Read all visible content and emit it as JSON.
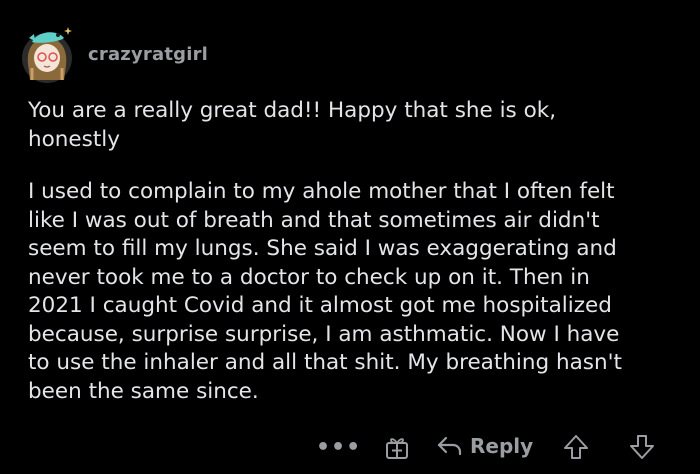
{
  "comment": {
    "username": "crazyratgirl",
    "paragraphs": [
      "You are a really great dad!! Happy that she is ok,\nhonestly",
      "I used to complain to my ahole mother that I often felt\nlike I was out of breath and that sometimes air didn't\nseem to fill my lungs. She said I was exaggerating and\nnever took me to a doctor to check up on it. Then in\n2021 I caught Covid and it almost got me hospitalized\nbecause, surprise surprise, I am asthmatic. Now I have\nto use the inhaler and all that shit. My breathing hasn't\nbeen the same since."
    ]
  },
  "actions": {
    "more_label": "•••",
    "reply_label": "Reply",
    "icons": [
      "more-icon",
      "award-icon",
      "reply-icon",
      "upvote-icon",
      "downvote-icon"
    ]
  },
  "colors": {
    "background": "#000000",
    "text": "#e3e5e8",
    "muted": "#9a9da1"
  }
}
